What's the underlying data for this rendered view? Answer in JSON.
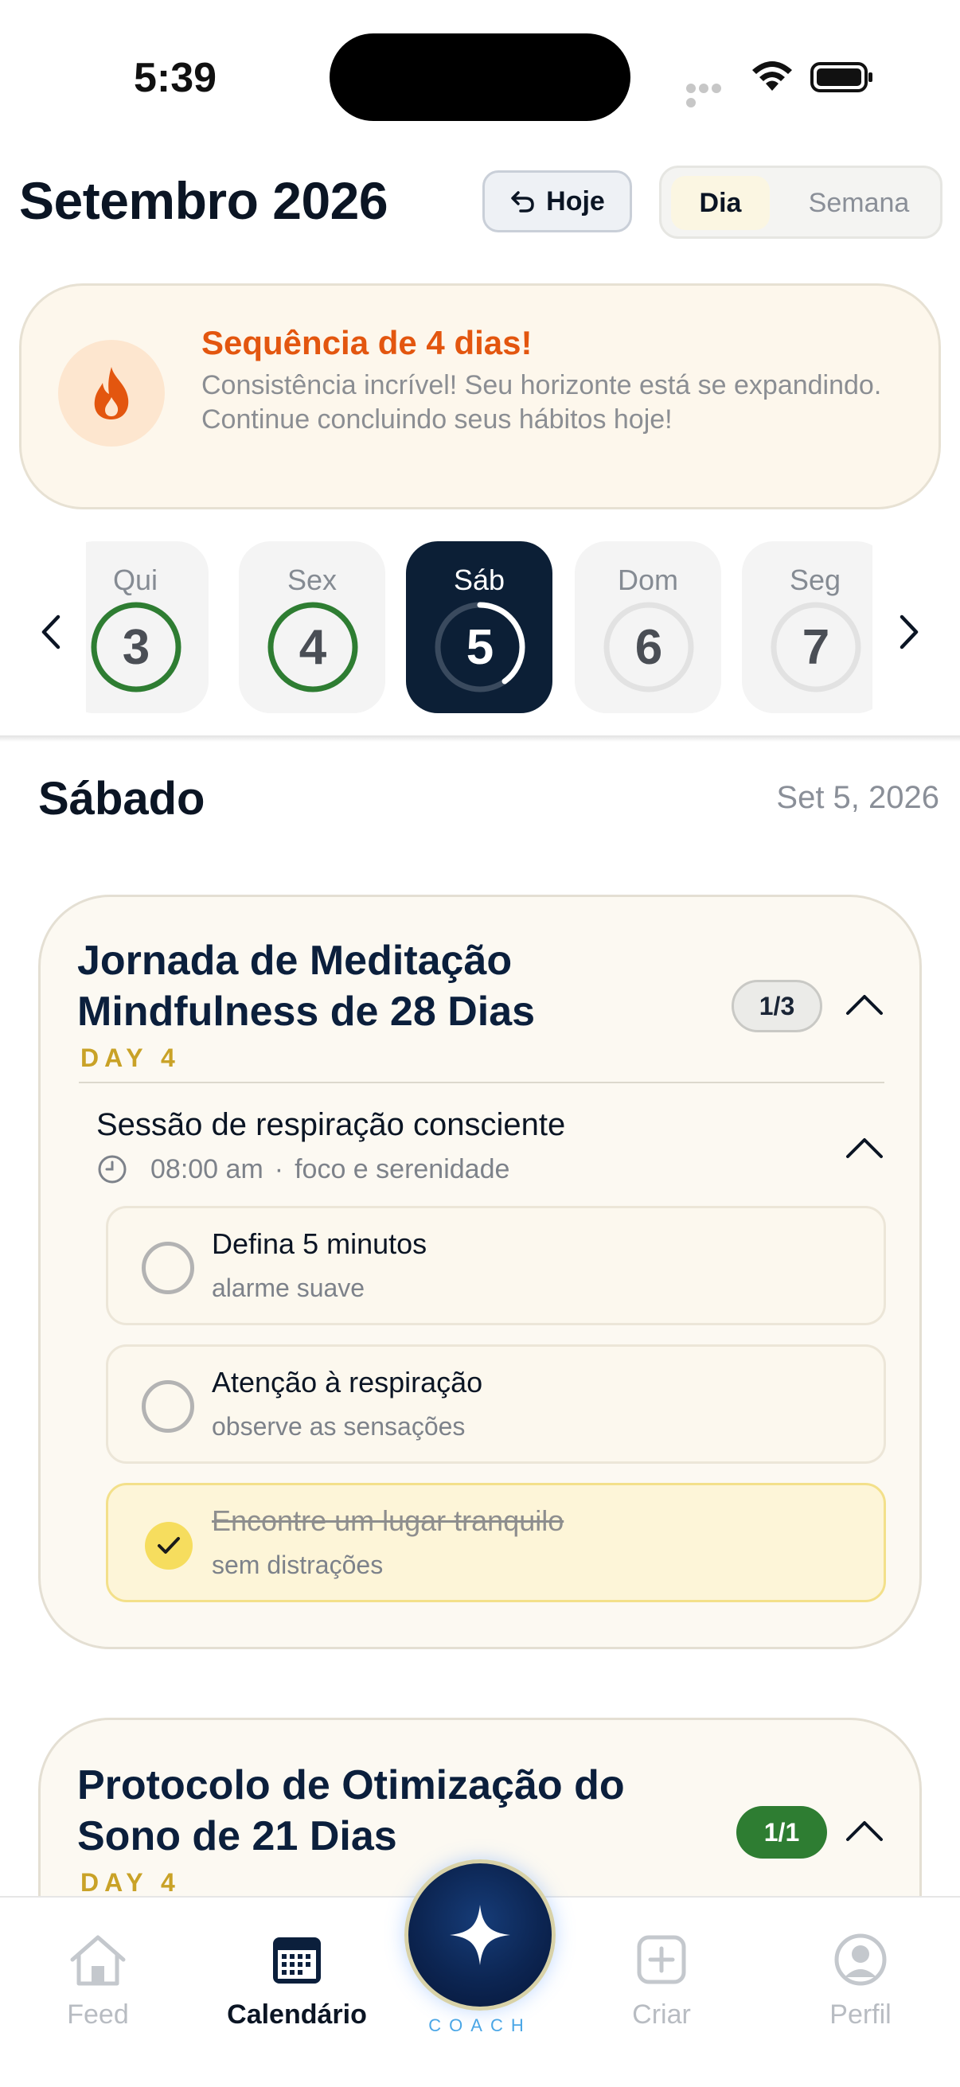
{
  "status_bar": {
    "time": "5:39"
  },
  "header": {
    "month_title": "Setembro 2026",
    "today_label": "Hoje",
    "view_day": "Dia",
    "view_week": "Semana"
  },
  "streak": {
    "title": "Sequência de 4 dias!",
    "message": "Consistência incrível! Seu horizonte está se expandindo. Continue concluindo seus hábitos hoje!",
    "icon": "flame-icon"
  },
  "day_strip": {
    "days": [
      {
        "name": "Qui",
        "number": "3",
        "state": "complete"
      },
      {
        "name": "Sex",
        "number": "4",
        "state": "complete"
      },
      {
        "name": "Sáb",
        "number": "5",
        "state": "selected",
        "progress": 0.4
      },
      {
        "name": "Dom",
        "number": "6",
        "state": "empty"
      },
      {
        "name": "Seg",
        "number": "7",
        "state": "empty"
      }
    ]
  },
  "selected_day": {
    "title": "Sábado",
    "date": "Set 5, 2026"
  },
  "programs": [
    {
      "title": "Jornada de Meditação Mindfulness de 28 Dias",
      "day_label": "DAY 4",
      "badge": "1/3",
      "session": {
        "title": "Sessão de respiração consciente",
        "time": "08:00 am",
        "separator": "·",
        "focus": "foco e serenidade"
      },
      "tasks": [
        {
          "title": "Defina 5 minutos",
          "subtitle": "alarme suave",
          "done": false
        },
        {
          "title": "Atenção à respiração",
          "subtitle": "observe as sensações",
          "done": false
        },
        {
          "title": "Encontre um lugar tranquilo",
          "subtitle": "sem distrações",
          "done": true
        }
      ]
    },
    {
      "title": "Protocolo de Otimização do Sono de 21 Dias",
      "day_label": "DAY 4",
      "badge": "1/1"
    }
  ],
  "tabbar": {
    "feed": "Feed",
    "calendar": "Calendário",
    "coach": "COACH",
    "create": "Criar",
    "profile": "Perfil"
  },
  "colors": {
    "accent_navy": "#0c1f36",
    "streak_orange": "#e3560f",
    "complete_green": "#2e7d32",
    "day_gold": "#c9a227",
    "check_yellow": "#f6dd5e"
  }
}
